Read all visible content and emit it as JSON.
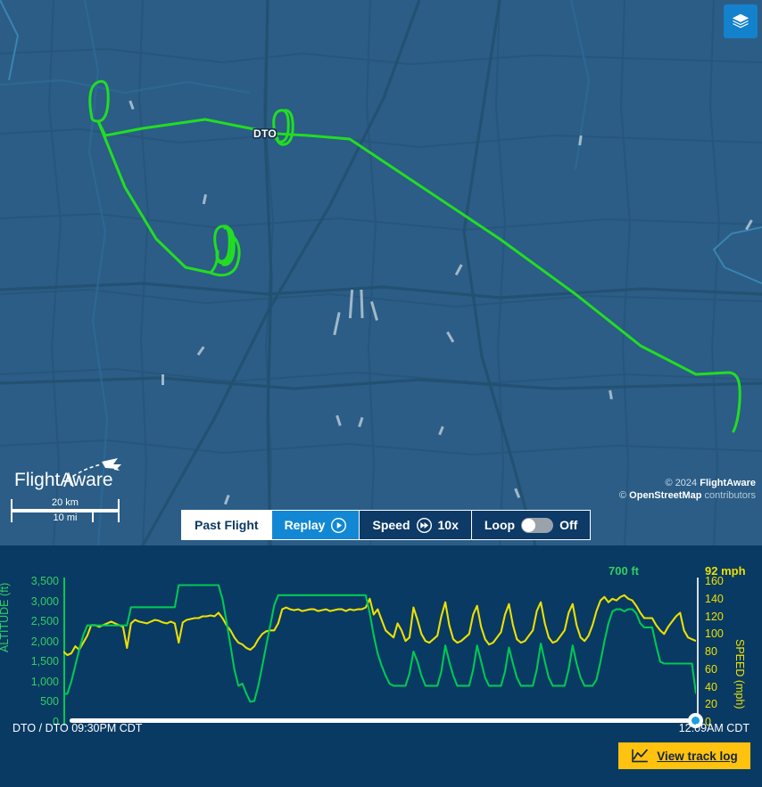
{
  "map": {
    "airport_label": "DTO",
    "layers_icon": "layers-icon",
    "logo_text": "FlightAware",
    "scale_km": "20 km",
    "scale_mi": "10 mi",
    "attribution_line1_prefix": "© 2024 ",
    "attribution_line1_brand": "FlightAware",
    "attribution_line2_prefix": "© ",
    "attribution_line2_brand": "OpenStreetMap",
    "attribution_line2_suffix": " contributors",
    "track_color": "#22dd22",
    "background_color": "#2b5d86"
  },
  "playback": {
    "past_flight_label": "Past Flight",
    "replay_label": "Replay",
    "replay_icon": "play-icon",
    "speed_label": "Speed",
    "speed_icon": "fast-forward-icon",
    "speed_value": "10x",
    "loop_label": "Loop",
    "loop_state": "Off",
    "active_tab": "Past Flight",
    "replay_color": "#1288d4"
  },
  "chart_panel": {
    "altitude_readout": "700 ft",
    "speed_readout": "92 mph",
    "start_label": "DTO / DTO 09:30PM CDT",
    "end_label": "12:09AM CDT",
    "slider_position_percent": 100
  },
  "track_log_button": {
    "label": "View track log",
    "icon": "line-chart-icon",
    "color": "#ffc20e"
  },
  "chart_data": {
    "type": "line",
    "title": "",
    "xlabel": "",
    "ylabel": "ALTITUDE (ft)",
    "y2label": "SPEED (mph)",
    "grid": false,
    "legend_position": "none",
    "x_start": "09:30PM CDT",
    "x_end": "12:09AM CDT",
    "ylim": [
      0,
      3500
    ],
    "y2lim": [
      0,
      160
    ],
    "yticks": [
      0,
      500,
      1000,
      1500,
      2000,
      2500,
      3000,
      3500
    ],
    "ytick_labels": [
      "0",
      "500",
      "1,000",
      "1,500",
      "2,000",
      "2,500",
      "3,000",
      "3,500"
    ],
    "y2ticks": [
      0,
      20,
      40,
      60,
      80,
      100,
      120,
      140,
      160
    ],
    "y2tick_labels": [
      "0",
      "20",
      "40",
      "60",
      "80",
      "100",
      "120",
      "140",
      "160"
    ],
    "series": [
      {
        "name": "Altitude (ft)",
        "color": "#00c853",
        "axis": "left",
        "values": [
          700,
          700,
          1000,
          1400,
          1800,
          2150,
          2400,
          2400,
          2400,
          2400,
          2400,
          2400,
          2400,
          2400,
          2400,
          2400,
          2400,
          2850,
          2850,
          2850,
          2850,
          2850,
          2850,
          2850,
          2850,
          2850,
          2850,
          2850,
          2850,
          3400,
          3400,
          3400,
          3400,
          3400,
          3400,
          3400,
          3400,
          3400,
          3400,
          3400,
          3050,
          2500,
          1900,
          1300,
          900,
          950,
          700,
          500,
          520,
          900,
          1400,
          1900,
          2400,
          2900,
          3150,
          3150,
          3150,
          3150,
          3150,
          3150,
          3150,
          3150,
          3150,
          3150,
          3150,
          3150,
          3150,
          3150,
          3150,
          3150,
          3150,
          3150,
          3150,
          3150,
          3150,
          3150,
          3150,
          2700,
          2150,
          1700,
          1400,
          1150,
          950,
          900,
          900,
          900,
          900,
          1200,
          1750,
          1500,
          1150,
          900,
          900,
          900,
          900,
          1250,
          1900,
          1500,
          1150,
          900,
          900,
          900,
          900,
          1300,
          1900,
          1500,
          1100,
          900,
          900,
          900,
          900,
          1250,
          1850,
          1450,
          1100,
          900,
          900,
          900,
          900,
          1300,
          1950,
          1500,
          1100,
          900,
          900,
          900,
          900,
          1300,
          1900,
          1450,
          1100,
          900,
          900,
          900,
          1050,
          1500,
          2000,
          2450,
          2750,
          2800,
          2800,
          2750,
          2800,
          2800,
          2700,
          2450,
          2350,
          2350,
          2350,
          1900,
          1500,
          1450,
          1450,
          1450,
          1450,
          1450,
          1450,
          1450,
          1450,
          700
        ]
      },
      {
        "name": "Speed (mph)",
        "color": "#ece000",
        "axis": "right",
        "values": [
          80,
          76,
          78,
          86,
          82,
          90,
          98,
          110,
          110,
          108,
          110,
          112,
          114,
          112,
          110,
          108,
          84,
          112,
          116,
          114,
          113,
          112,
          114,
          116,
          115,
          113,
          112,
          114,
          112,
          90,
          113,
          116,
          117,
          118,
          118,
          120,
          120,
          121,
          120,
          124,
          118,
          110,
          104,
          96,
          90,
          88,
          84,
          82,
          86,
          94,
          100,
          103,
          104,
          104,
          112,
          128,
          130,
          128,
          127,
          128,
          126,
          127,
          128,
          128,
          126,
          127,
          128,
          126,
          127,
          128,
          128,
          126,
          128,
          127,
          128,
          128,
          130,
          140,
          122,
          128,
          116,
          104,
          100,
          96,
          112,
          104,
          92,
          96,
          130,
          116,
          100,
          92,
          90,
          94,
          98,
          120,
          136,
          110,
          94,
          90,
          92,
          96,
          100,
          122,
          132,
          108,
          94,
          88,
          90,
          96,
          102,
          122,
          134,
          110,
          94,
          90,
          92,
          98,
          104,
          126,
          136,
          112,
          96,
          90,
          92,
          98,
          104,
          124,
          134,
          110,
          96,
          92,
          98,
          110,
          126,
          138,
          142,
          136,
          140,
          138,
          142,
          144,
          140,
          138,
          132,
          124,
          118,
          118,
          118,
          110,
          104,
          100,
          108,
          114,
          120,
          124,
          104,
          96,
          94,
          92
        ]
      }
    ]
  }
}
